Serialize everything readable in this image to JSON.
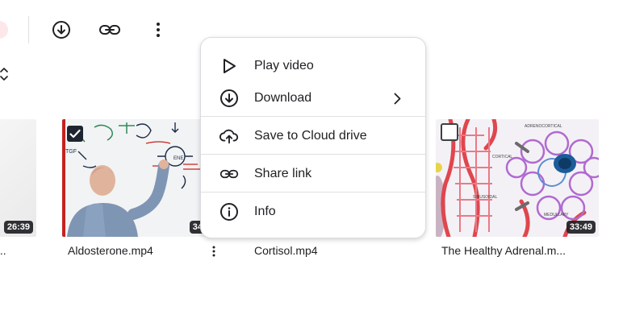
{
  "toolbar": {
    "buttons": [
      {
        "icon": "download-icon"
      },
      {
        "icon": "link-icon"
      },
      {
        "icon": "more-vert-icon"
      }
    ]
  },
  "files": [
    {
      "name": "...",
      "duration": "26:39",
      "selected": false
    },
    {
      "name": "Aldosterone.mp4",
      "duration": "34",
      "selected": true
    },
    {
      "name": "Cortisol.mp4",
      "duration": "",
      "selected": false
    },
    {
      "name": "The Healthy Adrenal.m...",
      "duration": "33:49",
      "selected": false
    }
  ],
  "context_menu": {
    "items": [
      {
        "label": "Play video",
        "icon": "play-icon"
      },
      {
        "label": "Download",
        "icon": "download-icon",
        "submenu": true
      },
      {
        "label": "Save to Cloud drive",
        "icon": "cloud-upload-icon"
      },
      {
        "label": "Share link",
        "icon": "link-icon"
      },
      {
        "label": "Info",
        "icon": "info-icon"
      }
    ]
  },
  "colors": {
    "accent_red": "#c5221f",
    "badge_bg": "#202124",
    "menu_border": "#dadce0"
  }
}
